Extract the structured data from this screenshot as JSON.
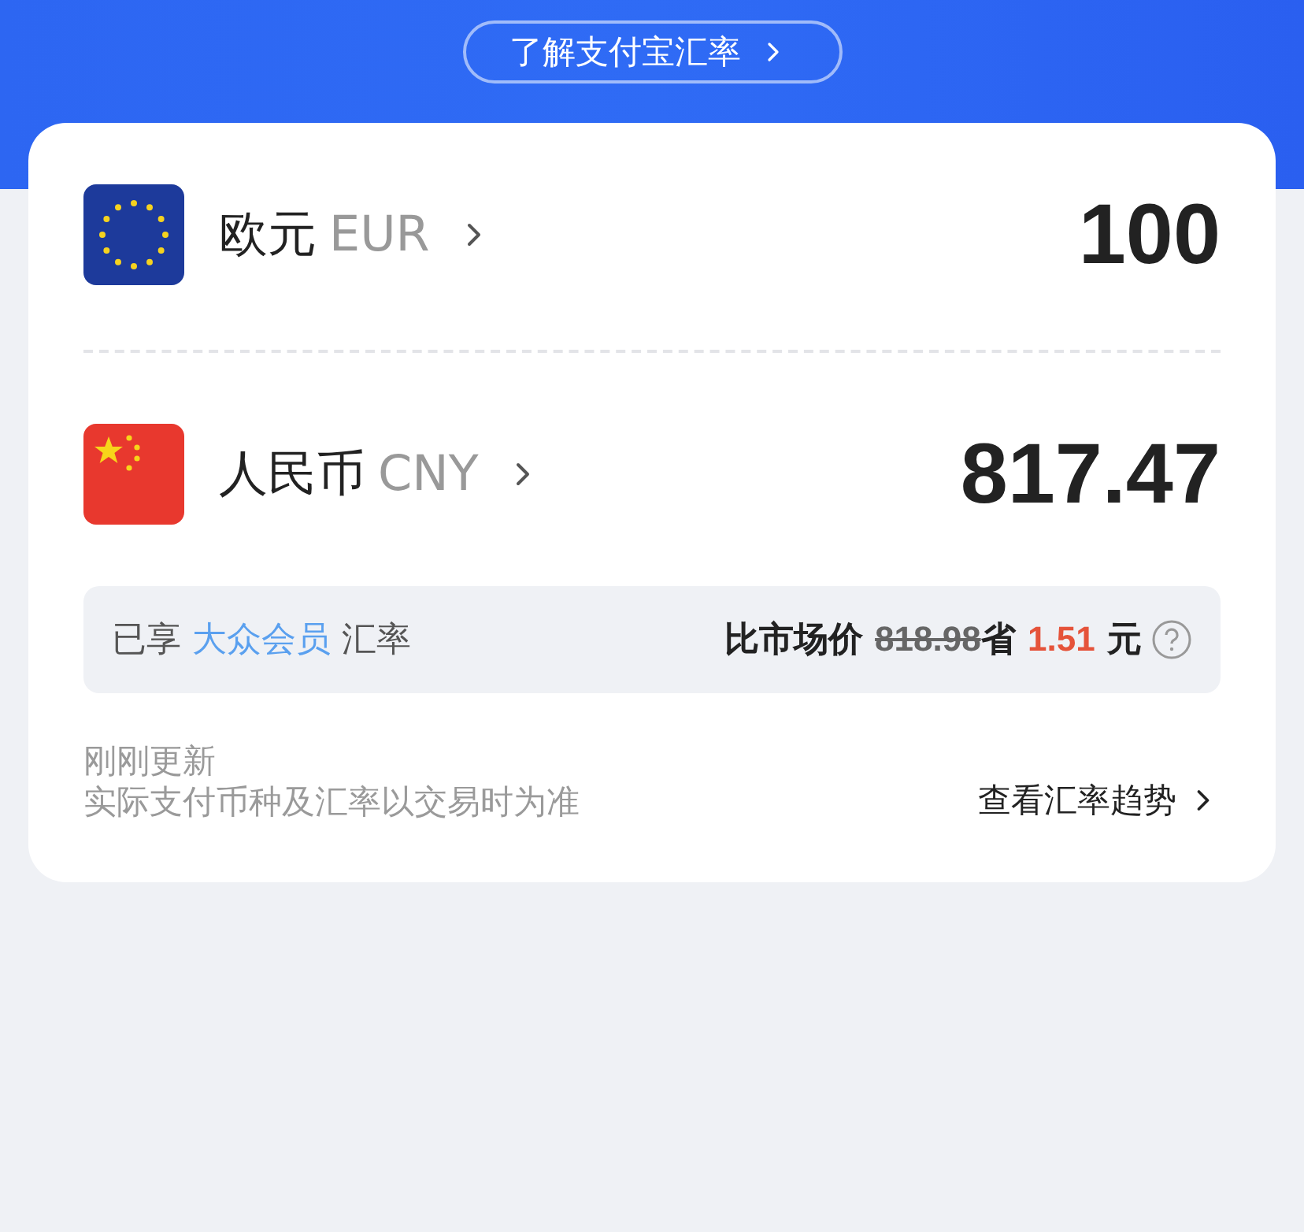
{
  "banner_link": {
    "label": "了解支付宝汇率"
  },
  "currencies": [
    {
      "kind": "eu",
      "name": "欧元",
      "code": "EUR",
      "amount": "100"
    },
    {
      "kind": "cn",
      "name": "人民币",
      "code": "CNY",
      "amount": "817.47"
    }
  ],
  "rate_info": {
    "prefix": "已享",
    "tier": "大众会员",
    "suffix": "汇率",
    "compare_label": "比市场价",
    "market_price": "818.98",
    "save_label": "省",
    "saved": "1.51",
    "unit": "元"
  },
  "footer": {
    "updated": "刚刚更新",
    "note": "实际支付币种及汇率以交易时为准",
    "trend_link": "查看汇率趋势"
  }
}
